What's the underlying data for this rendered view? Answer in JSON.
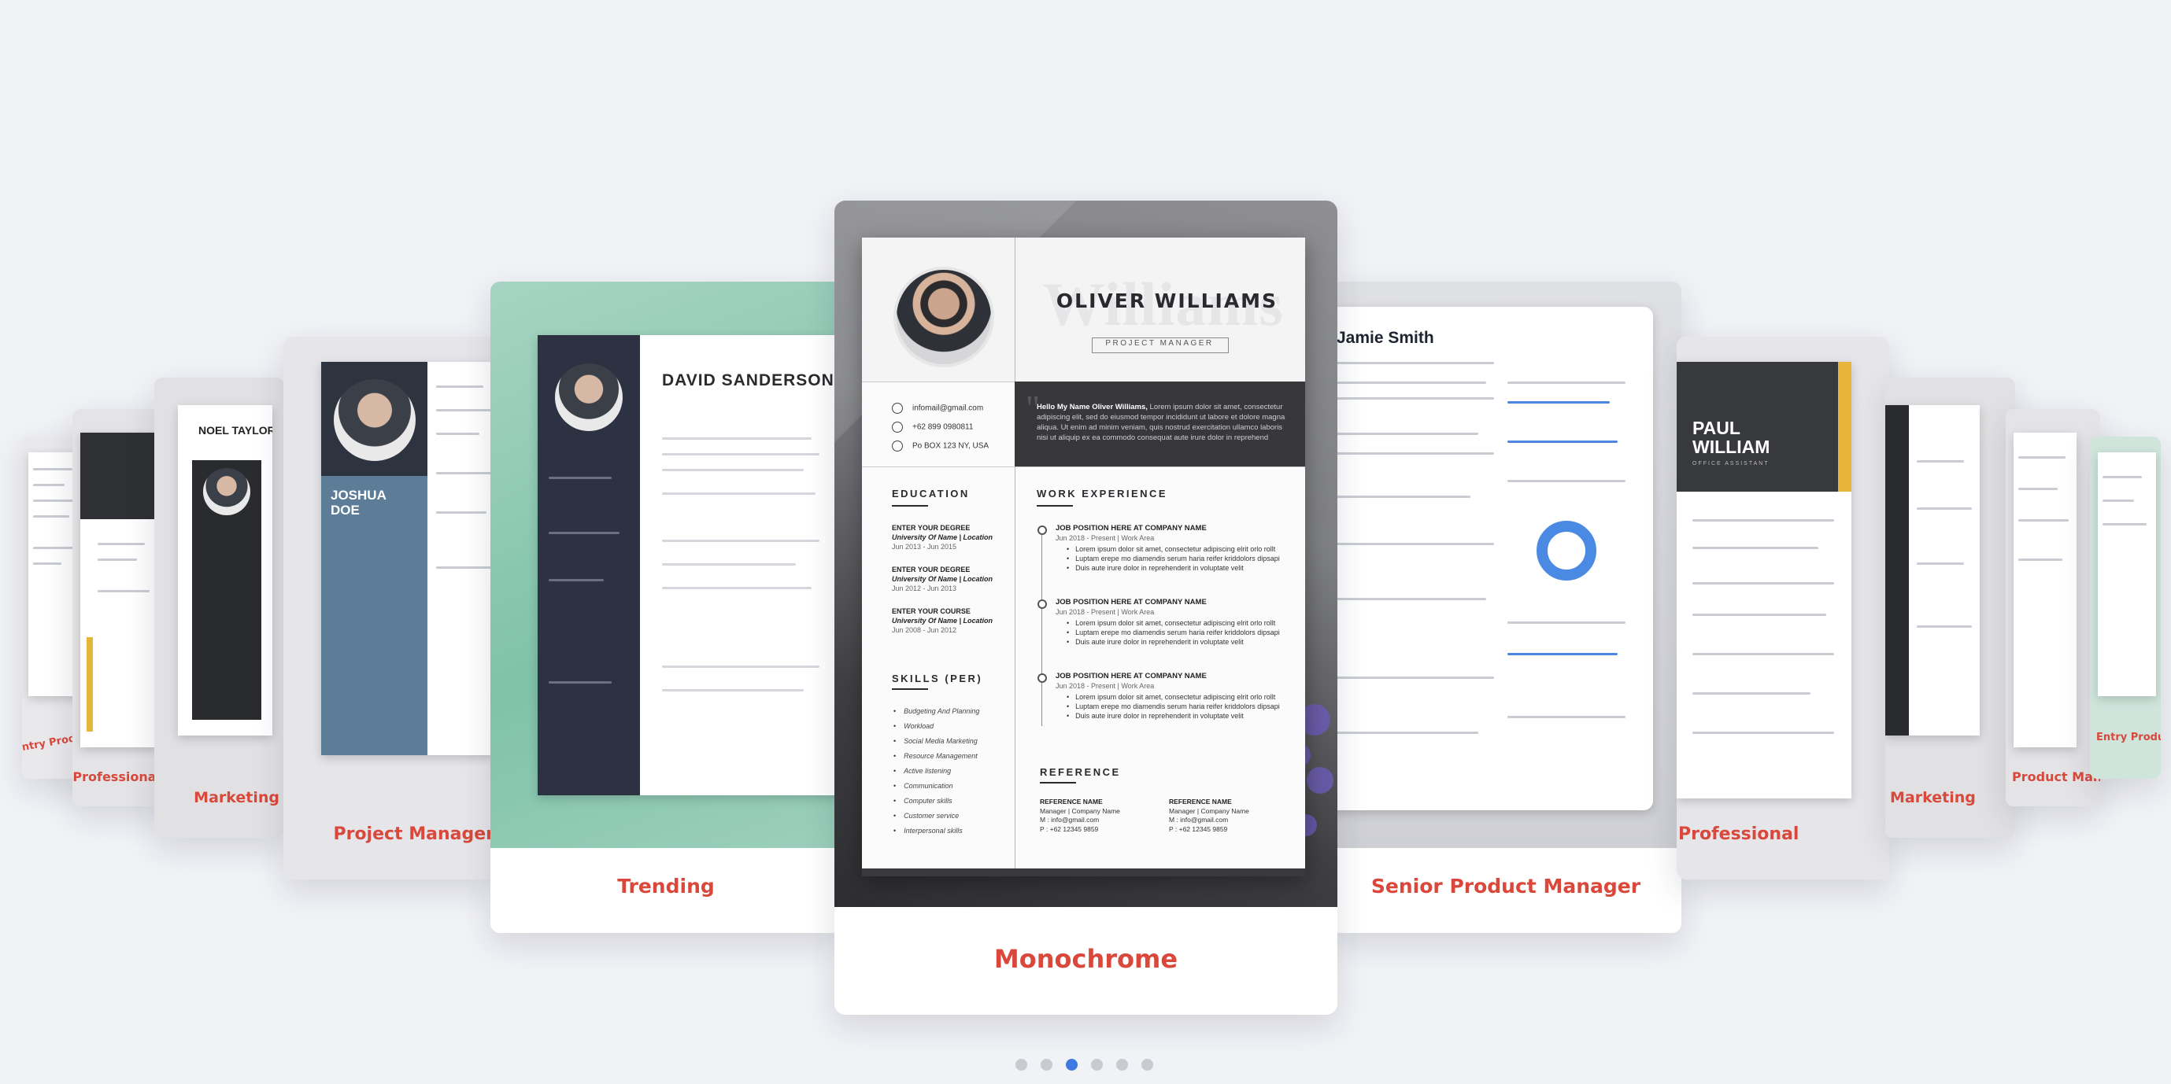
{
  "cards": {
    "far_left_4": "Entry Product Manager",
    "far_left_3": "Professional",
    "far_left_2": "Marketing",
    "left_1": "Project Manager",
    "left_0": "Trending",
    "center": "Monochrome",
    "right_0": "Senior Product Manager",
    "right_1": "Professional",
    "right_2": "Marketing",
    "right_3": "Product Manager",
    "right_4": "Entry Product Manager"
  },
  "center_resume": {
    "name": "OLIVER WILLIAMS",
    "name_watermark": "Williams",
    "role": "PROJECT MANAGER",
    "email": "infomail@gmail.com",
    "phone": "+62 899 0980811",
    "address": "Po BOX 123 NY, USA",
    "about_lead": "Hello My Name Oliver Williams,",
    "about_text": " Lorem ipsum dolor sit amet, consectetur adipiscing elit, sed do eiusmod tempor incididunt ut labore et dolore magna aliqua. Ut enim ad minim veniam, quis nostrud exercitation ullamco laboris nisi ut aliquip ex ea commodo consequat aute irure dolor in reprehend",
    "education_title": "EDUCATION",
    "education": [
      {
        "title": "ENTER YOUR DEGREE",
        "school": "University Of Name | Location",
        "date": "Jun 2013 - Jun 2015"
      },
      {
        "title": "ENTER YOUR DEGREE",
        "school": "University Of Name | Location",
        "date": "Jun 2012 - Jun 2013"
      },
      {
        "title": "ENTER YOUR COURSE",
        "school": "University Of Name | Location",
        "date": "Jun 2008 - Jun 2012"
      }
    ],
    "skills_title": "SKILLS (PER)",
    "skills": [
      "Budgeting And Planning",
      "Workload",
      "Social Media Marketing",
      "Resource Management",
      "Active listening",
      "Communication",
      "Computer skills",
      "Customer service",
      "Interpersonal skills"
    ],
    "work_title": "WORK EXPERIENCE",
    "jobs": [
      {
        "title": "JOB POSITION HERE AT COMPANY NAME",
        "sub": "Jun 2018 - Present | Work Area",
        "b1": "Lorem ipsum dolor sit amet, consectetur adipiscing elrit orlo rollt",
        "b2": "Luptam erepe mo diamendis serum haria reifer kriddolors dipsapi",
        "b3": "Duis aute irure dolor in reprehenderit in voluptate velit"
      },
      {
        "title": "JOB POSITION HERE AT COMPANY NAME",
        "sub": "Jun 2018 - Present | Work Area",
        "b1": "Lorem ipsum dolor sit amet, consectetur adipiscing elrit orlo rollt",
        "b2": "Luptam erepe mo diamendis serum haria reifer kriddolors dipsapi",
        "b3": "Duis aute irure dolor in reprehenderit in voluptate velit"
      },
      {
        "title": "JOB POSITION HERE AT COMPANY NAME",
        "sub": "Jun 2018 - Present | Work Area",
        "b1": "Lorem ipsum dolor sit amet, consectetur adipiscing elrit orlo rollt",
        "b2": "Luptam erepe mo diamendis serum haria reifer kriddolors dipsapi",
        "b3": "Duis aute irure dolor in reprehenderit in voluptate velit"
      }
    ],
    "reference_title": "REFERENCE",
    "references": [
      {
        "name": "REFERENCE NAME",
        "company": "Manager | Company Name",
        "mail": "M : info@gmail.com",
        "phone": "P : +62 12345 9859"
      },
      {
        "name": "REFERENCE NAME",
        "company": "Manager | Company Name",
        "mail": "M : info@gmail.com",
        "phone": "P : +62 12345 9859"
      }
    ]
  },
  "side_titles": {
    "david": "DAVID SANDERSON",
    "joshua": "JOSHUA DOE",
    "noel": "NOEL TAYLOR",
    "jamie": "Jamie Smith",
    "paul": "PAUL WILLIAM",
    "paul_role": "OFFICE ASSISTANT"
  },
  "colors": {
    "accent_label": "#d9483b",
    "active_dot": "#3d79e0",
    "inactive_dot": "#c8cad2"
  },
  "pagination": {
    "count": 6,
    "active_index": 2
  }
}
